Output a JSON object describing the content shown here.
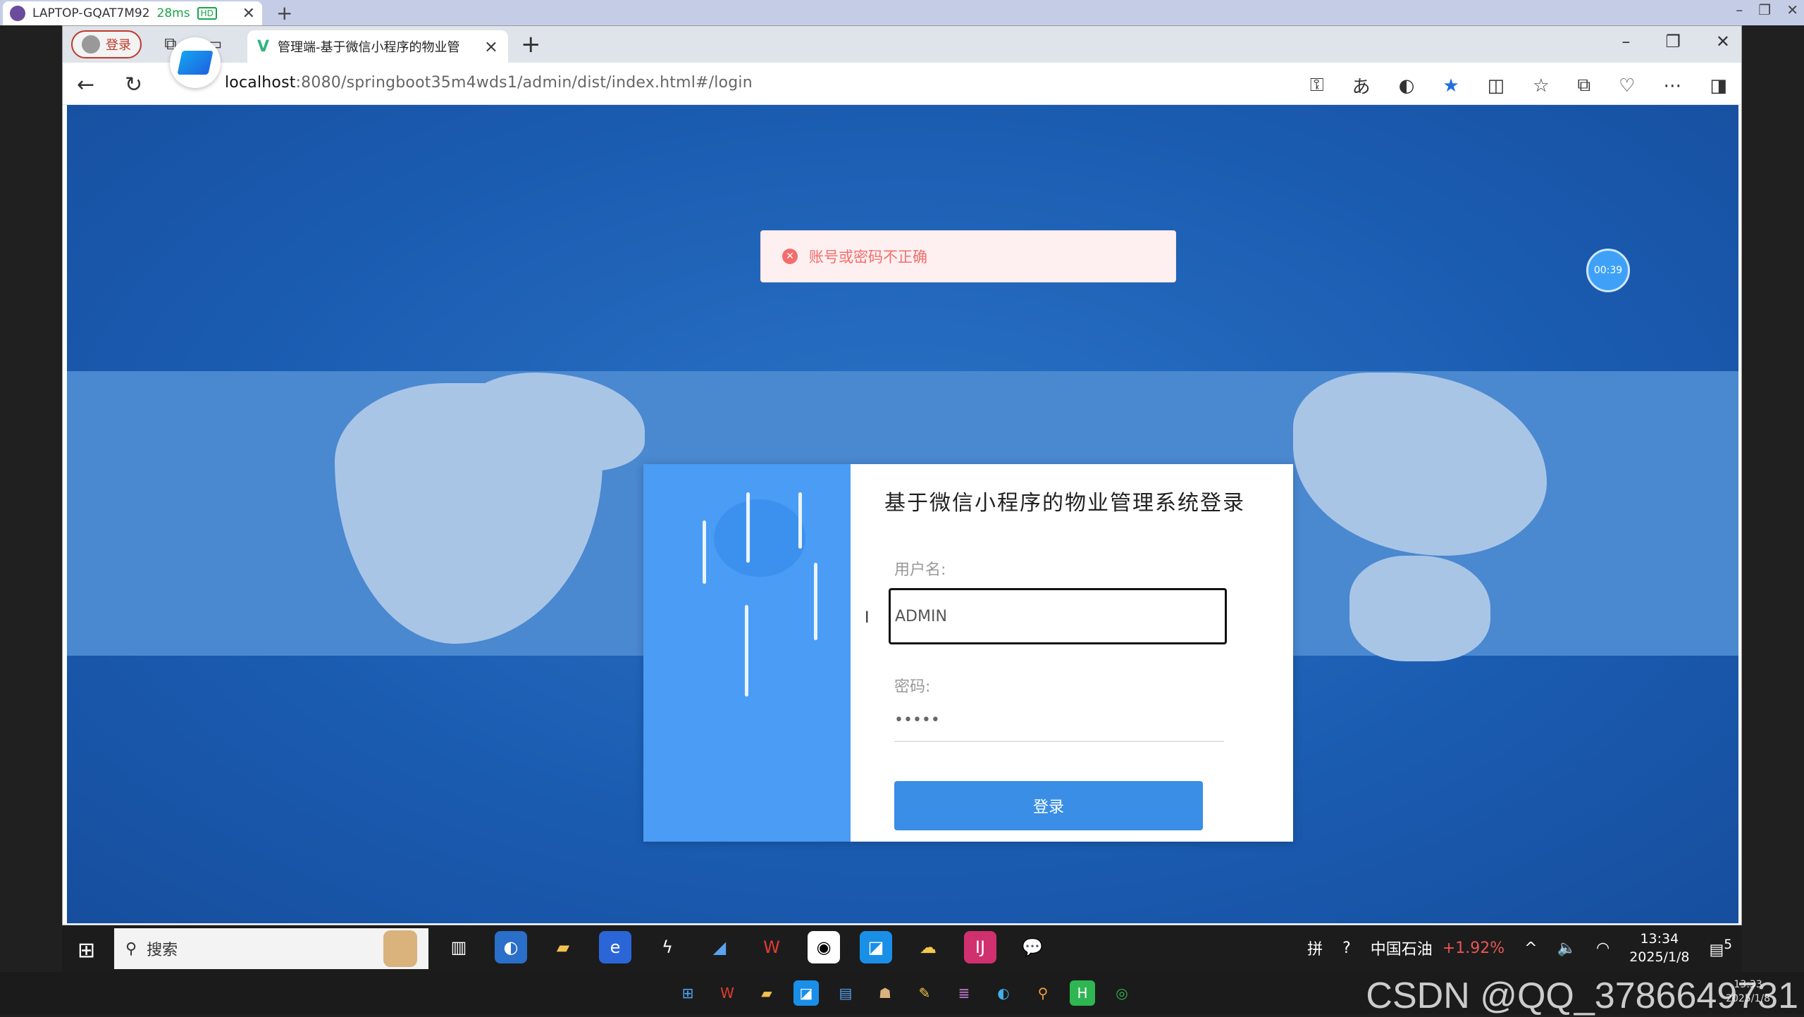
{
  "remote": {
    "machine": "LAPTOP-GQAT7M92",
    "ping": "28ms",
    "hd": "HD"
  },
  "browser": {
    "profile_label": "登录",
    "tab_title": "管理端-基于微信小程序的物业管",
    "url_host": "localhost",
    "url_rest": ":8080/springboot35m4wds1/admin/dist/index.html#/login"
  },
  "page": {
    "toast_message": "账号或密码不正确",
    "timer": "00:39",
    "login": {
      "title": "基于微信小程序的物业管理系统登录",
      "username_label": "用户名:",
      "username_value": "ADMIN",
      "password_label": "密码:",
      "password_value": "•••••",
      "submit_label": "登录"
    }
  },
  "taskbar": {
    "search_placeholder": "搜索",
    "stock_name": "中国石油",
    "stock_change": "+1.92%",
    "time": "13:34",
    "date": "2025/1/8",
    "notification_count": "5"
  },
  "taskbar2": {
    "time": "13:33",
    "date": "2025/1/8",
    "watermark": "CSDN @QQ_3786649731"
  },
  "colors": {
    "page_bg": "#1a5bb0",
    "accent": "#3a8ee6",
    "error": "#f56c6c"
  }
}
